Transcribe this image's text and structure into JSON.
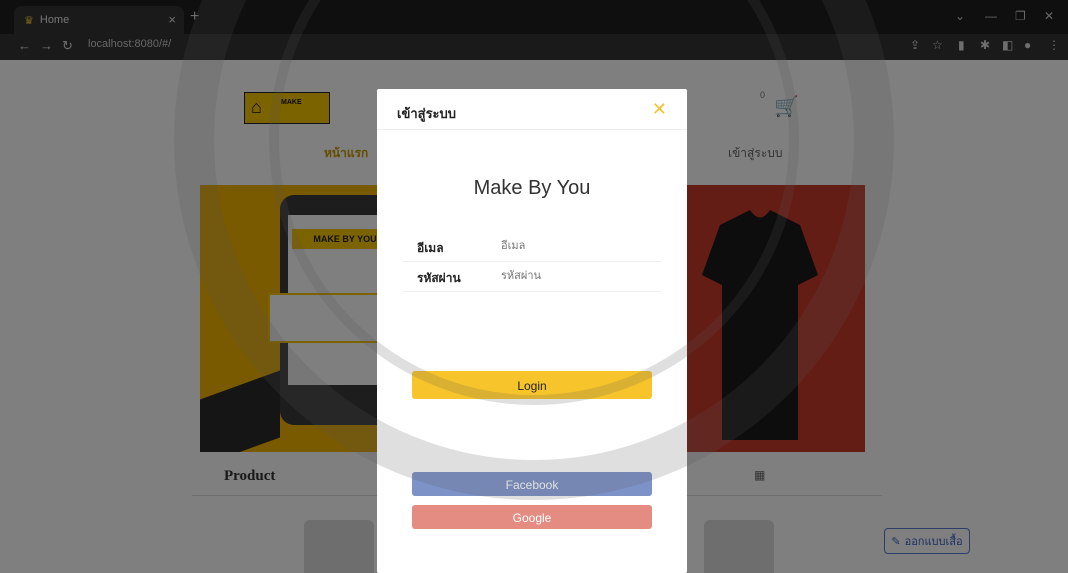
{
  "browser": {
    "tab_title": "Home",
    "url": "localhost:8080/#/"
  },
  "header": {
    "logo_text": "MAKE",
    "nav_home": "หน้าแรก",
    "nav_login": "เข้าสู่ระบบ",
    "cart_count": "0"
  },
  "banner": {
    "tag_text": "MAKE BY YOU"
  },
  "product_section": {
    "title": "Product",
    "design_button": "ออกแบบเสื้อ"
  },
  "modal": {
    "title": "เข้าสู่ระบบ",
    "brand": "Make By You",
    "email_label": "อีเมล",
    "email_placeholder": "อีเมล",
    "password_label": "รหัสผ่าน",
    "password_placeholder": "รหัสผ่าน",
    "login_button": "Login",
    "facebook_button": "Facebook",
    "google_button": "Google"
  },
  "colors": {
    "accent": "#f7c52b",
    "facebook": "#7d93c8",
    "google": "#e48c82"
  }
}
